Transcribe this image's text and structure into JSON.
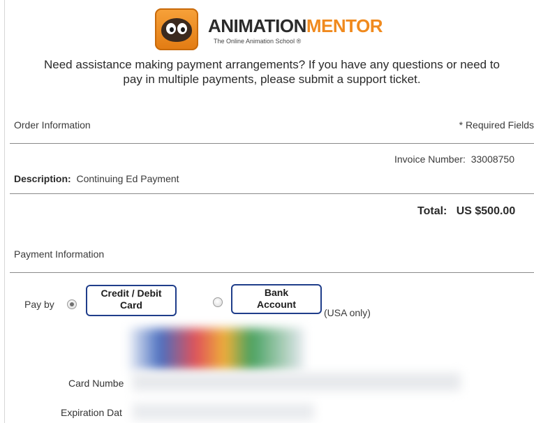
{
  "header": {
    "brand_part1": "ANIMATION",
    "brand_part2": "MENTOR",
    "tagline": "The Online Animation School ®",
    "accent_color": "#f08a1e"
  },
  "assistance": {
    "line1": "Need assistance making payment arrangements? If you have any questions or need to",
    "line2": "pay in multiple payments, please submit a support ticket."
  },
  "order": {
    "section_title": "Order Information",
    "required_note": "* Required Fields",
    "invoice_label": "Invoice Number:",
    "invoice_number": "33008750",
    "description_label": "Description:",
    "description_value": "Continuing Ed Payment",
    "total_label": "Total:",
    "total_value": "US $500.00"
  },
  "payment": {
    "section_title": "Payment Information",
    "pay_by_label": "Pay by",
    "options": [
      {
        "line1": "Credit / Debit",
        "line2": "Card",
        "selected": true
      },
      {
        "line1": "Bank",
        "line2": "Account",
        "selected": false,
        "note": "(USA only)"
      }
    ],
    "card_number_label": "Card Numbe",
    "expiration_label": "Expiration Dat",
    "button_border_color": "#1f3d8a"
  }
}
